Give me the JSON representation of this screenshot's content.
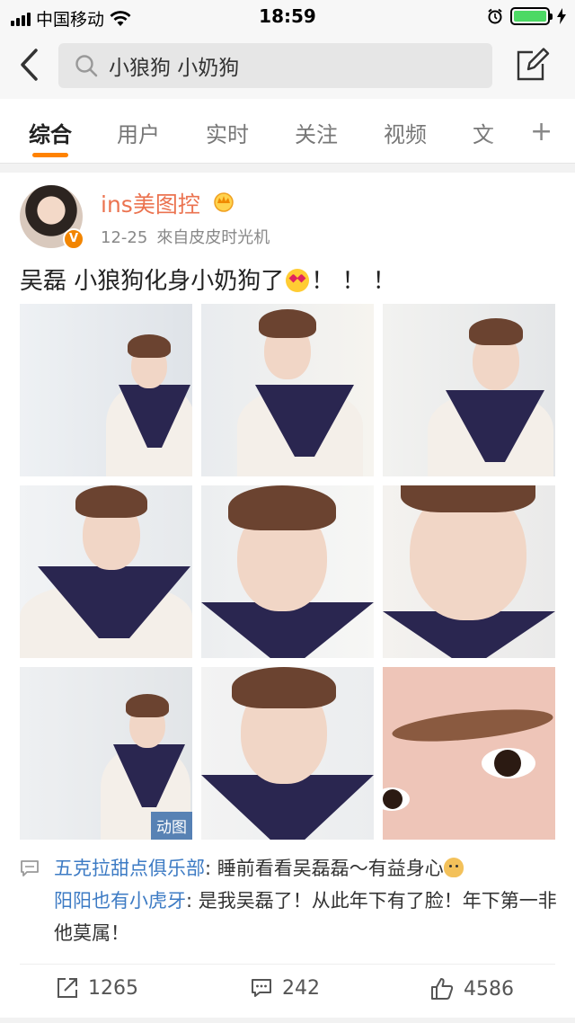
{
  "status_bar": {
    "carrier": "中国移动",
    "time": "18:59",
    "icons": [
      "signal-icon",
      "wifi-icon",
      "alarm-icon",
      "battery-icon",
      "charging-icon"
    ]
  },
  "search": {
    "query": "小狼狗 小奶狗",
    "icons": [
      "back-arrow-icon",
      "search-icon",
      "compose-icon"
    ]
  },
  "tabs": [
    {
      "label": "综合",
      "active": true
    },
    {
      "label": "用户"
    },
    {
      "label": "实时"
    },
    {
      "label": "关注"
    },
    {
      "label": "视频"
    },
    {
      "label": "文"
    }
  ],
  "tab_more": "+",
  "post": {
    "username": "ins美图控",
    "verified_badge": "V",
    "date": "12-25",
    "source": "來自皮皮时光机",
    "text_before": "吴磊  小狼狗化身小奶狗了",
    "text_after": "！ ！ ！",
    "gif_label": "动图",
    "accent_color": "#eb7350"
  },
  "comments": [
    {
      "user": "五克拉甜点俱乐部",
      "text": ": 睡前看看吴磊磊～有益身心"
    },
    {
      "user": "阳阳也有小虎牙",
      "text": ": 是我吴磊了！从此年下有了脸！年下第一非他莫属！"
    }
  ],
  "actions": {
    "reposts": "1265",
    "comments": "242",
    "likes": "4586"
  }
}
